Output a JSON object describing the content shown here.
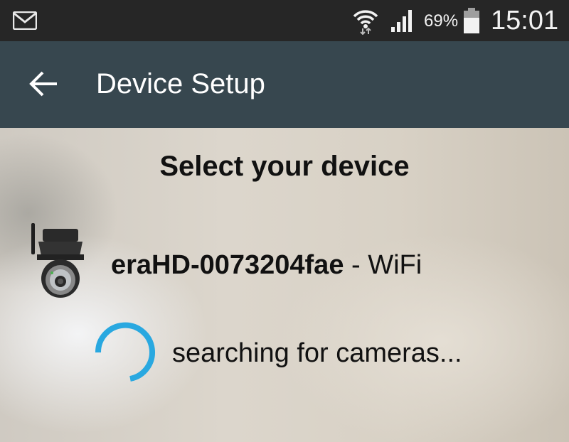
{
  "status_bar": {
    "notification_icon": "gmail-icon",
    "wifi_icon": "wifi-icon",
    "signal_icon": "cell-signal-icon",
    "battery_percent": "69%",
    "battery_icon": "battery-icon",
    "time": "15:01"
  },
  "app_bar": {
    "back_icon": "arrow-back-icon",
    "title": "Device Setup",
    "background": "#37474f"
  },
  "content": {
    "heading": "Select your device",
    "device": {
      "icon": "ip-camera-icon",
      "name": "eraHD-0073204fae",
      "connection": "- WiFi"
    },
    "spinner_color": "#29a8e0",
    "status_text": "searching for cameras..."
  }
}
